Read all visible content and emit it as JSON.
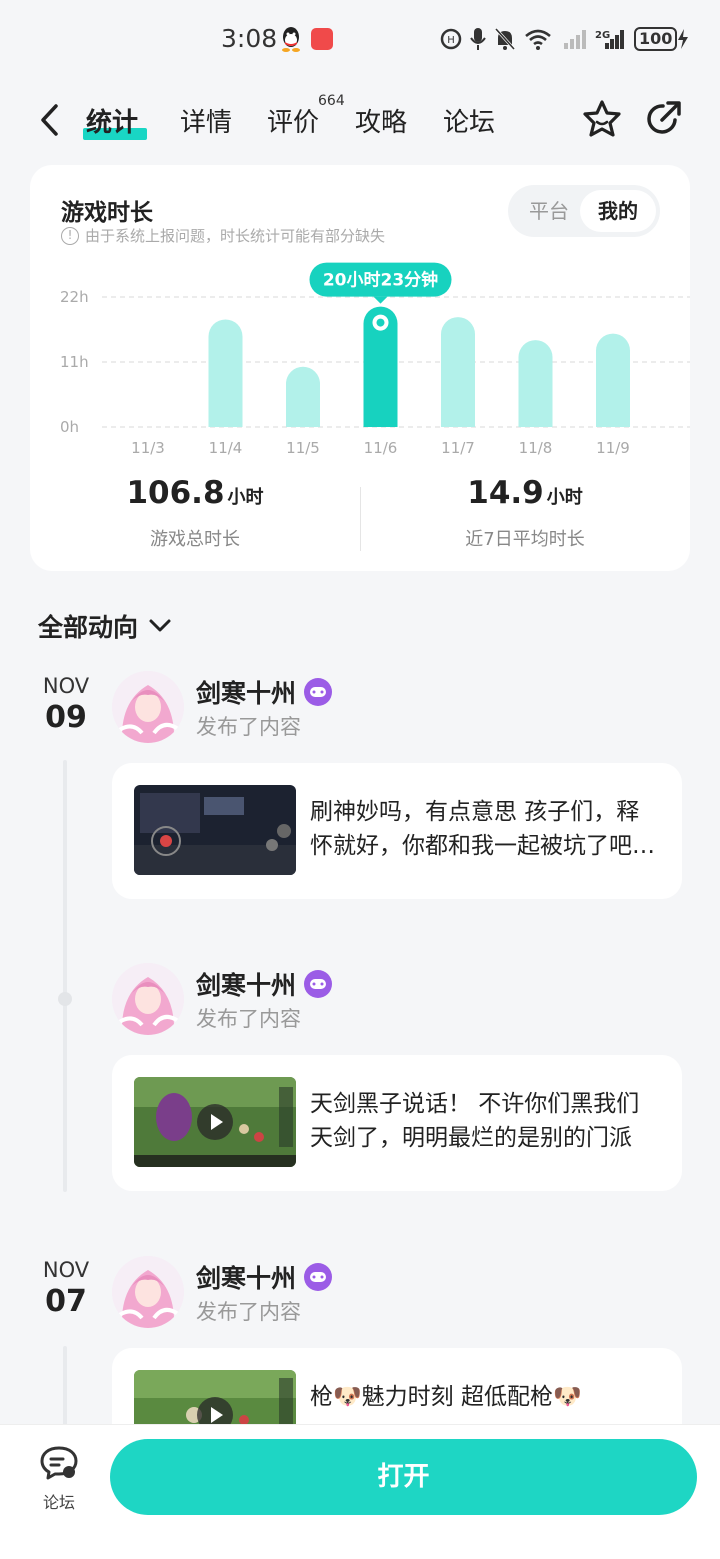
{
  "status_bar": {
    "time": "3:08",
    "battery": "100"
  },
  "nav": {
    "tabs": [
      {
        "label": "统计",
        "active": true
      },
      {
        "label": "详情"
      },
      {
        "label": "评价",
        "badge": "664"
      },
      {
        "label": "攻略"
      },
      {
        "label": "论坛"
      }
    ],
    "icons": [
      "back-icon",
      "star-icon",
      "share-icon"
    ]
  },
  "playtime": {
    "title": "游戏时长",
    "note": "由于系统上报问题，时长统计可能有部分缺失",
    "toggle": {
      "options": [
        "平台",
        "我的"
      ],
      "selected": "我的"
    },
    "tooltip": "20小时23分钟",
    "total_value": "106.8",
    "total_unit": "小时",
    "total_label": "游戏总时长",
    "avg_value": "14.9",
    "avg_unit": "小时",
    "avg_label": "近7日平均时长"
  },
  "chart_data": {
    "type": "bar",
    "categories": [
      "11/3",
      "11/4",
      "11/5",
      "11/6",
      "11/7",
      "11/8",
      "11/9"
    ],
    "values": [
      0,
      18.2,
      10.2,
      20.38,
      18.6,
      14.7,
      15.8
    ],
    "y_ticks": [
      "0h",
      "11h",
      "22h"
    ],
    "ylim": [
      0,
      22
    ],
    "highlight_index": 3,
    "colors": {
      "bar": "#b2f1ea",
      "highlight": "#17d2bf"
    }
  },
  "feed": {
    "filter_label": "全部动向",
    "groups": [
      {
        "month": "NOV",
        "day": "09",
        "posts": [
          {
            "user": "剑寒十州",
            "action": "发布了内容",
            "text": "刷神妙吗，有点意思 孩子们，释怀就好，你都和我一起被坑了吧哈哈",
            "video": false
          },
          {
            "user": "剑寒十州",
            "action": "发布了内容",
            "text": "天剑黑子说话！ 不许你们黑我们天剑了，明明最烂的是别的门派",
            "video": true
          }
        ]
      },
      {
        "month": "NOV",
        "day": "07",
        "posts": [
          {
            "user": "剑寒十州",
            "action": "发布了内容",
            "text": "枪🐶魅力时刻 超低配枪🐶",
            "video": true
          }
        ]
      }
    ]
  },
  "bottom": {
    "forum_label": "论坛",
    "open_label": "打开"
  }
}
